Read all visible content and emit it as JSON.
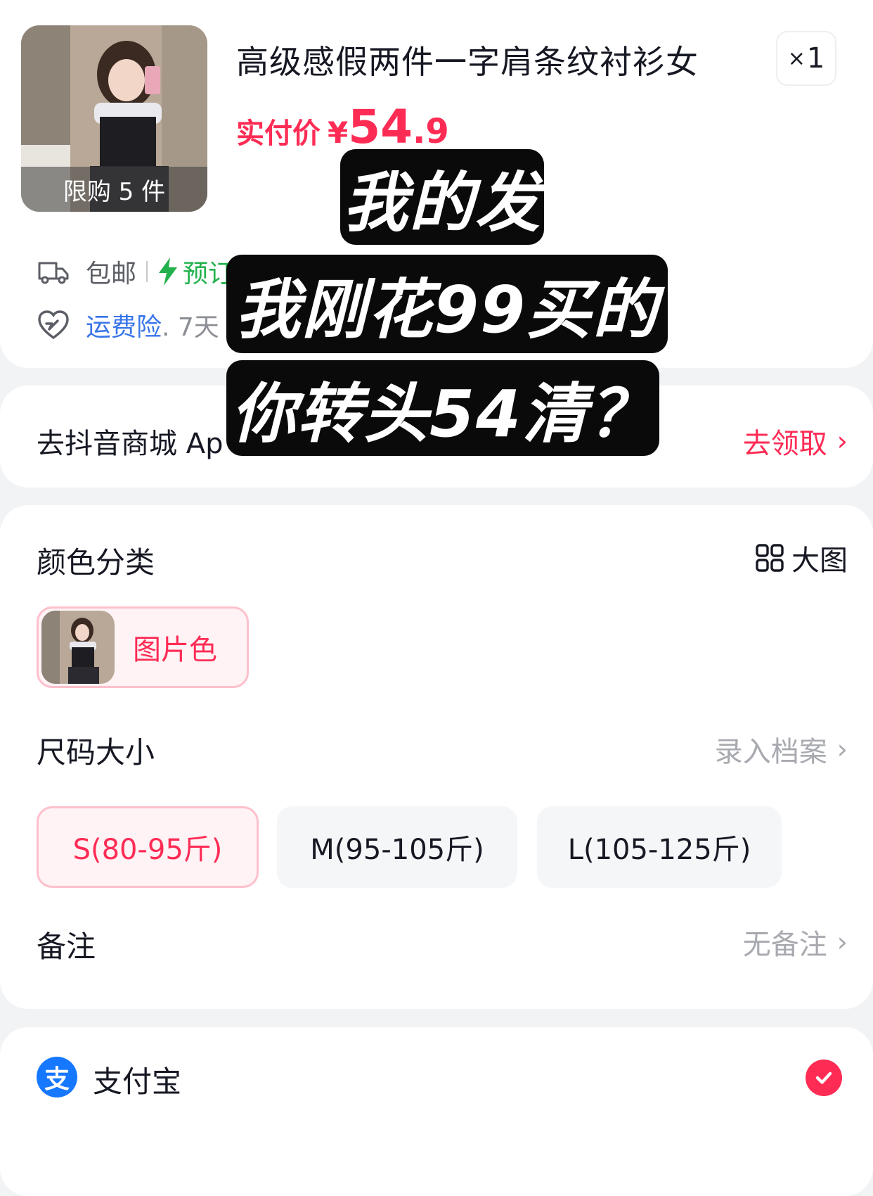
{
  "product": {
    "title": "高级感假两件一字肩条纹衬衫女",
    "limit_badge": "限购 5 件",
    "quantity_prefix": "×",
    "quantity": "1",
    "price_label": "实付价",
    "currency": "¥",
    "price_int": "54",
    "price_dec": ".9",
    "shipping": "包邮",
    "presale_partial": "预订",
    "insurance": "运费险",
    "insurance_extra": " . 7天"
  },
  "coupon": {
    "text": "去抖音商城 Ap",
    "action": "去领取"
  },
  "spec": {
    "color_title": "颜色分类",
    "big_image": "大图",
    "color_option": "图片色",
    "size_title": "尺码大小",
    "size_profile": "录入档案",
    "sizes": [
      "S(80-95斤)",
      "M(95-105斤)",
      "L(105-125斤)"
    ],
    "selected_size_index": 0,
    "note_title": "备注",
    "note_value": "无备注"
  },
  "payment": {
    "icon_glyph": "支",
    "method": "支付宝"
  },
  "captions": {
    "line1": "我的发",
    "line2": "我刚花99买的",
    "line3": "你转头54清？"
  },
  "colors": {
    "accent": "#fe2c55",
    "link_blue": "#3875e9",
    "green": "#22b14c",
    "alipay": "#1677ff"
  }
}
